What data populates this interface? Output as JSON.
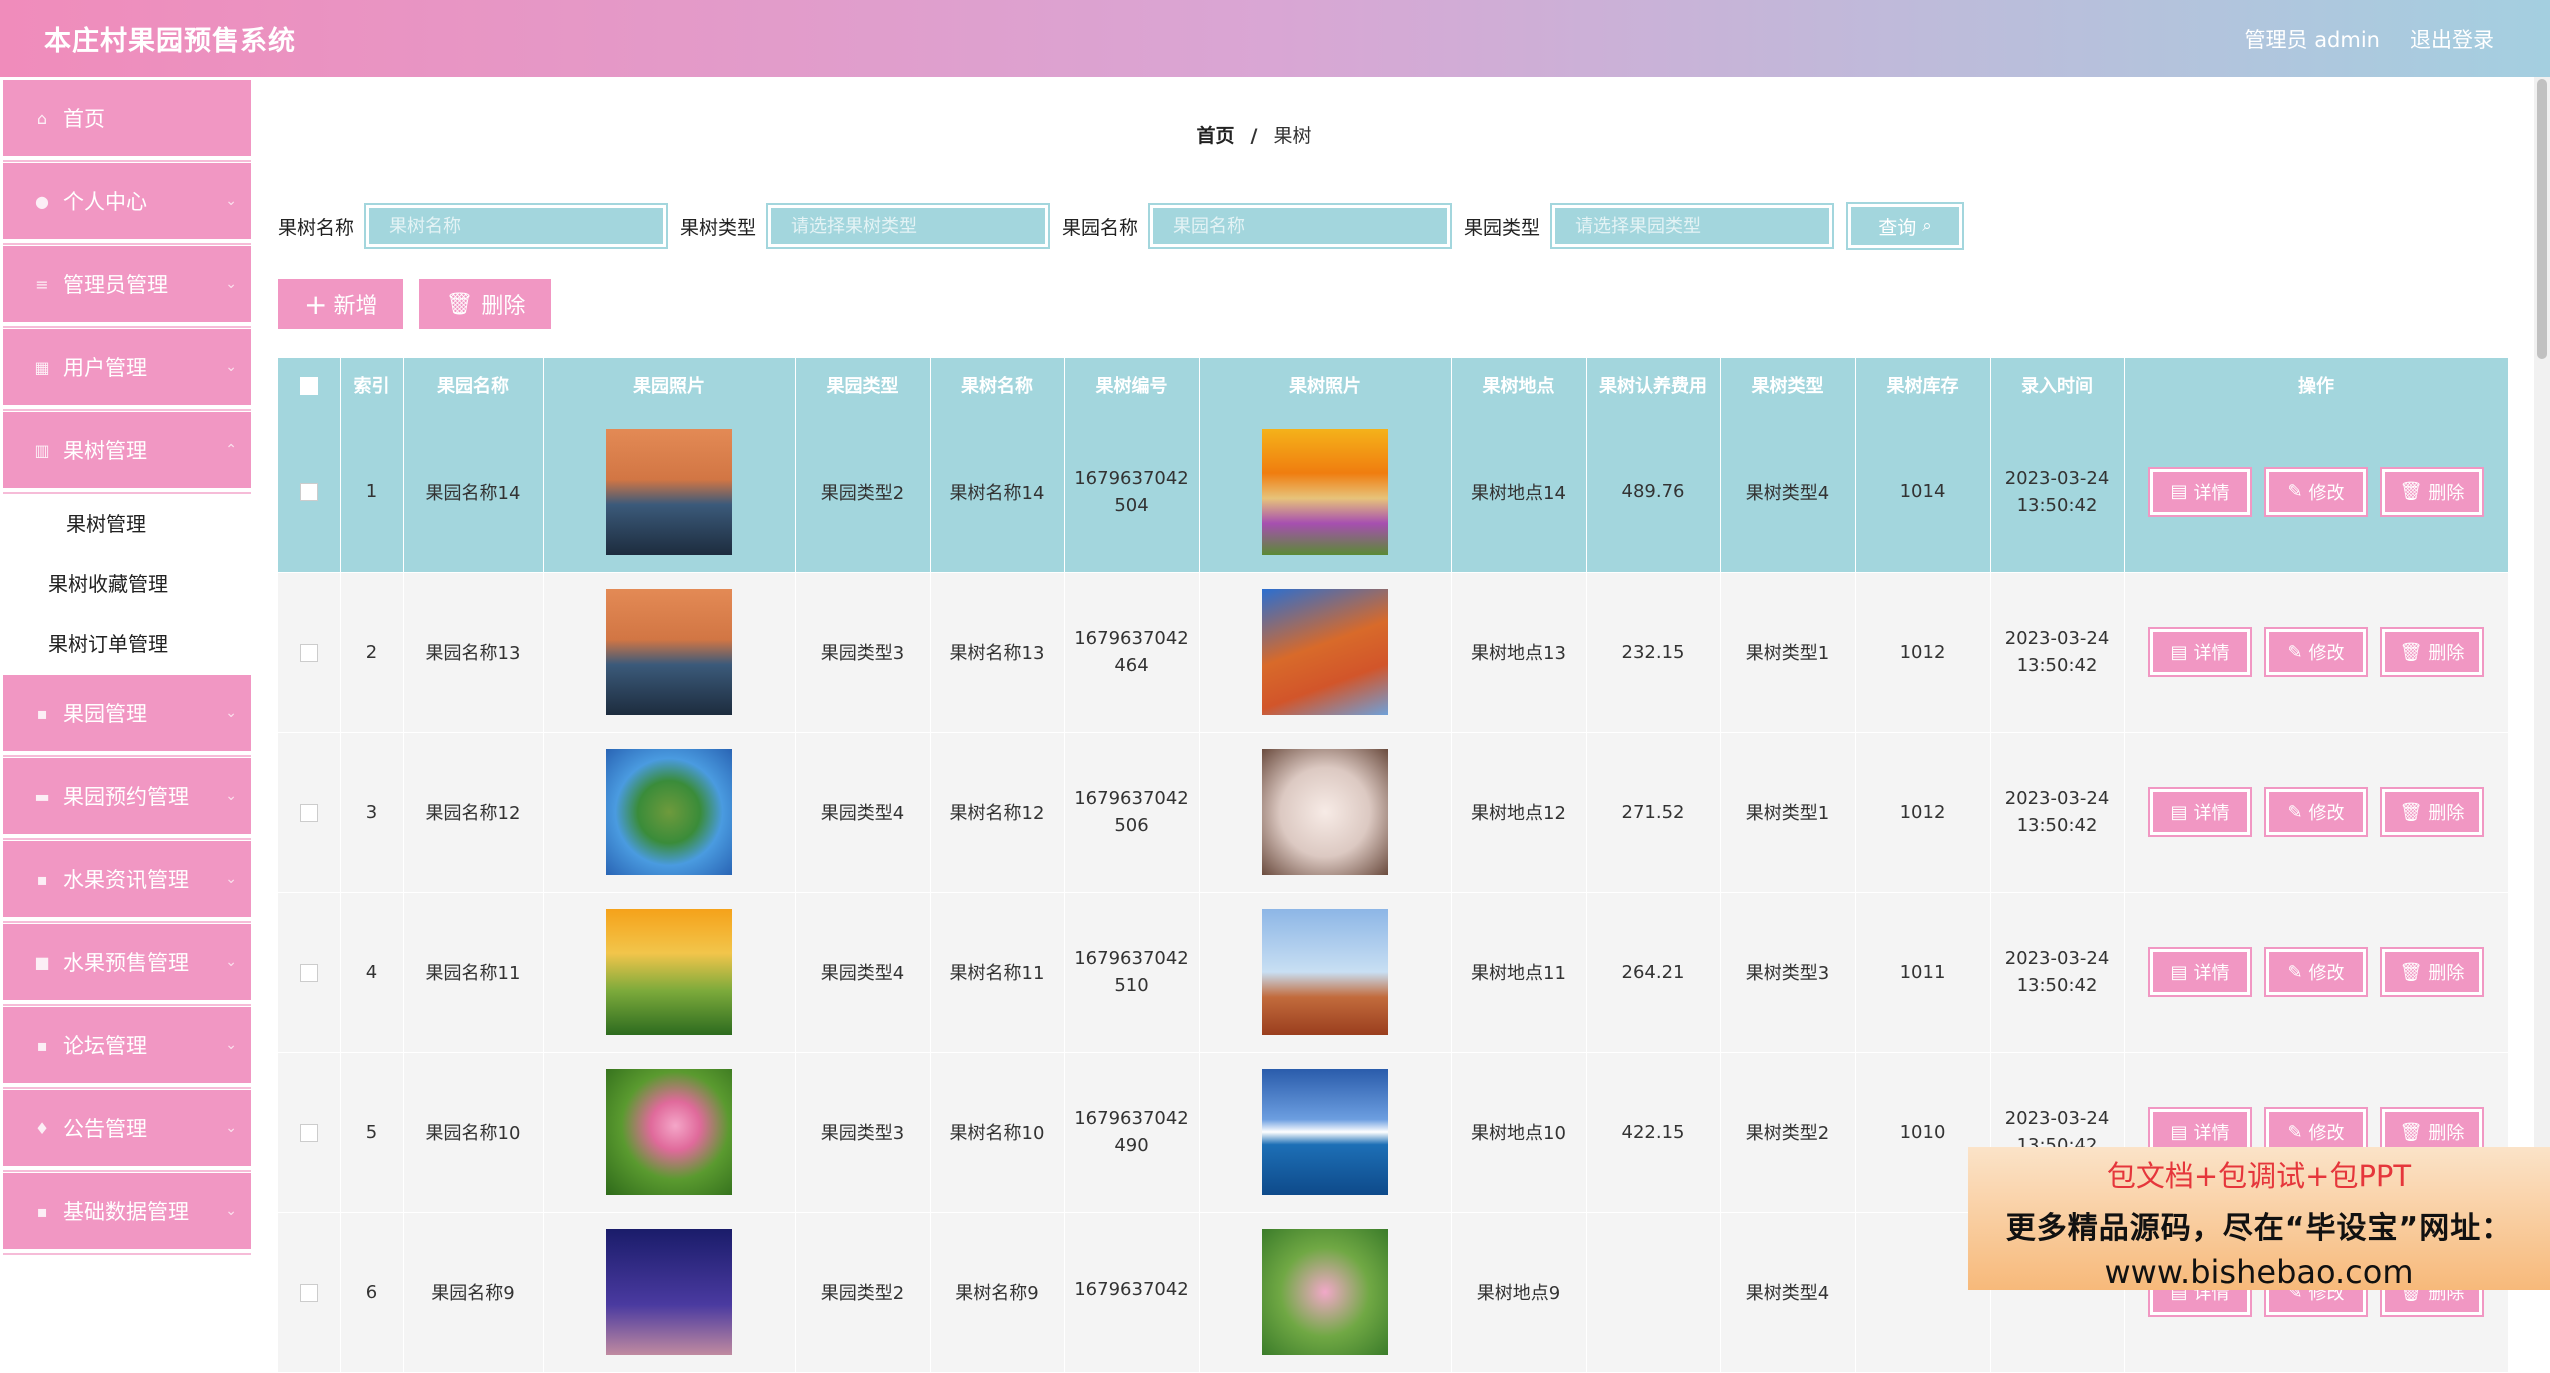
{
  "header": {
    "title": "本庄村果园预售系统",
    "user": "管理员 admin",
    "logout": "退出登录"
  },
  "sidebar": {
    "items": [
      {
        "label": "首页",
        "icon": "home-icon"
      },
      {
        "label": "个人中心",
        "icon": "user-icon"
      },
      {
        "label": "管理员管理",
        "icon": "list-icon"
      },
      {
        "label": "用户管理",
        "icon": "users-icon"
      },
      {
        "label": "果树管理",
        "icon": "chart-icon"
      }
    ],
    "sub_items": [
      "果树管理",
      "果树收藏管理",
      "果树订单管理"
    ],
    "items_after": [
      {
        "label": "果园管理",
        "icon": "grid-icon"
      },
      {
        "label": "果园预约管理",
        "icon": "chat-icon"
      },
      {
        "label": "水果资讯管理",
        "icon": "grid-icon"
      },
      {
        "label": "水果预售管理",
        "icon": "box-icon"
      },
      {
        "label": "论坛管理",
        "icon": "grid-icon"
      },
      {
        "label": "公告管理",
        "icon": "bell-icon"
      },
      {
        "label": "基础数据管理",
        "icon": "grid-icon"
      }
    ]
  },
  "breadcrumb": {
    "home": "首页",
    "sep": "/",
    "current": "果树"
  },
  "search": {
    "fields": [
      {
        "label": "果树名称",
        "placeholder": "果树名称"
      },
      {
        "label": "果树类型",
        "placeholder": "请选择果树类型"
      },
      {
        "label": "果园名称",
        "placeholder": "果园名称"
      },
      {
        "label": "果园类型",
        "placeholder": "请选择果园类型"
      }
    ],
    "query": "查询"
  },
  "actions": {
    "add": "新增",
    "delete": "删除"
  },
  "table": {
    "headers": [
      "索引",
      "果园名称",
      "果园照片",
      "果园类型",
      "果树名称",
      "果树编号",
      "果树照片",
      "果树地点",
      "果树认养费用",
      "果树类型",
      "果树库存",
      "录入时间",
      "操作"
    ],
    "ops": {
      "detail": "详情",
      "edit": "修改",
      "delete": "删除"
    },
    "rows": [
      {
        "index": "1",
        "garden_name": "果园名称14",
        "garden_type": "果园类型2",
        "tree_name": "果树名称14",
        "tree_no_1": "1679637042",
        "tree_no_2": "504",
        "location": "果树地点14",
        "fee": "489.76",
        "tree_type": "果树类型4",
        "stock": "1014",
        "date": "2023-03-24",
        "time": "13:50:42"
      },
      {
        "index": "2",
        "garden_name": "果园名称13",
        "garden_type": "果园类型3",
        "tree_name": "果树名称13",
        "tree_no_1": "1679637042",
        "tree_no_2": "464",
        "location": "果树地点13",
        "fee": "232.15",
        "tree_type": "果树类型1",
        "stock": "1012",
        "date": "2023-03-24",
        "time": "13:50:42"
      },
      {
        "index": "3",
        "garden_name": "果园名称12",
        "garden_type": "果园类型4",
        "tree_name": "果树名称12",
        "tree_no_1": "1679637042",
        "tree_no_2": "506",
        "location": "果树地点12",
        "fee": "271.52",
        "tree_type": "果树类型1",
        "stock": "1012",
        "date": "2023-03-24",
        "time": "13:50:42"
      },
      {
        "index": "4",
        "garden_name": "果园名称11",
        "garden_type": "果园类型4",
        "tree_name": "果树名称11",
        "tree_no_1": "1679637042",
        "tree_no_2": "510",
        "location": "果树地点11",
        "fee": "264.21",
        "tree_type": "果树类型3",
        "stock": "1011",
        "date": "2023-03-24",
        "time": "13:50:42"
      },
      {
        "index": "5",
        "garden_name": "果园名称10",
        "garden_type": "果园类型3",
        "tree_name": "果树名称10",
        "tree_no_1": "1679637042",
        "tree_no_2": "490",
        "location": "果树地点10",
        "fee": "422.15",
        "tree_type": "果树类型2",
        "stock": "1010",
        "date": "2023-03-24",
        "time": "13:50:42"
      },
      {
        "index": "6",
        "garden_name": "果园名称9",
        "garden_type": "果园类型2",
        "tree_name": "果树名称9",
        "tree_no_1": "1679637042",
        "tree_no_2": "",
        "location": "果树地点9",
        "fee": "",
        "tree_type": "果树类型4",
        "stock": "",
        "date": "",
        "time": ""
      }
    ]
  },
  "watermark": {
    "line1": "包文档+包调试+包PPT",
    "line2": "更多精品源码，尽在“毕设宝”网址：",
    "line3": "www.bishebao.com"
  }
}
